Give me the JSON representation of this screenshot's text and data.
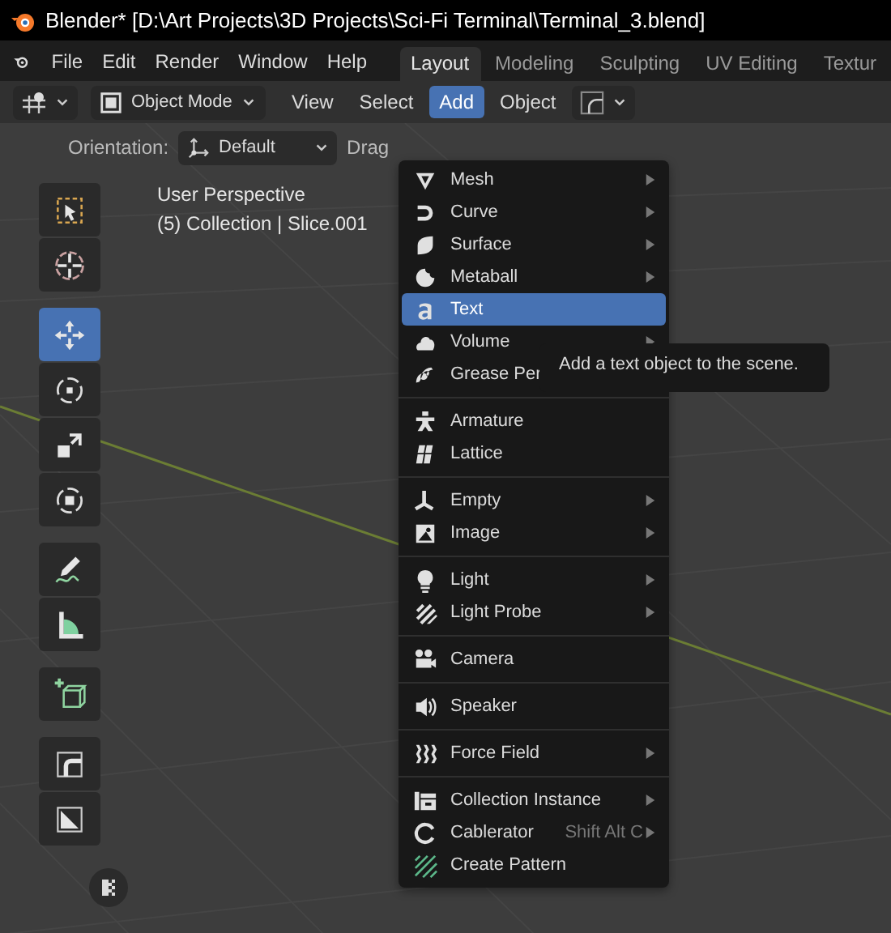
{
  "window": {
    "title": "Blender* [D:\\Art Projects\\3D Projects\\Sci-Fi Terminal\\Terminal_3.blend]"
  },
  "menu_bar": [
    "File",
    "Edit",
    "Render",
    "Window",
    "Help"
  ],
  "workspace_tabs": [
    {
      "label": "Layout",
      "selected": true
    },
    {
      "label": "Modeling",
      "selected": false
    },
    {
      "label": "Sculpting",
      "selected": false
    },
    {
      "label": "UV Editing",
      "selected": false
    },
    {
      "label": "Textur",
      "selected": false
    }
  ],
  "header": {
    "mode": "Object Mode",
    "menus": [
      {
        "label": "View",
        "selected": false
      },
      {
        "label": "Select",
        "selected": false
      },
      {
        "label": "Add",
        "selected": true
      },
      {
        "label": "Object",
        "selected": false
      }
    ]
  },
  "tool_settings": {
    "orientation_label": "Orientation:",
    "orientation": "Default",
    "drag_label": "Drag"
  },
  "viewport": {
    "view_name": "User Perspective",
    "context": "(5) Collection | Slice.001"
  },
  "toolbar": [
    [
      {
        "selected": false
      },
      {
        "selected": false
      }
    ],
    [
      {
        "selected": true
      },
      {
        "selected": false
      },
      {
        "selected": false
      },
      {
        "selected": false
      }
    ],
    [
      {
        "selected": false
      },
      {
        "selected": false
      }
    ],
    [
      {
        "selected": false
      }
    ],
    [
      {
        "selected": false
      },
      {
        "selected": false
      }
    ]
  ],
  "add_menu": [
    [
      {
        "label": "Mesh",
        "submenu": true,
        "selected": false
      },
      {
        "label": "Curve",
        "submenu": true,
        "selected": false
      },
      {
        "label": "Surface",
        "submenu": true,
        "selected": false
      },
      {
        "label": "Metaball",
        "submenu": true,
        "selected": false
      },
      {
        "label": "Text",
        "submenu": false,
        "selected": true
      },
      {
        "label": "Volume",
        "submenu": true,
        "selected": false
      },
      {
        "label": "Grease Per",
        "submenu": false,
        "selected": false
      }
    ],
    [
      {
        "label": "Armature",
        "submenu": false,
        "selected": false
      },
      {
        "label": "Lattice",
        "submenu": false,
        "selected": false
      }
    ],
    [
      {
        "label": "Empty",
        "submenu": true,
        "selected": false
      },
      {
        "label": "Image",
        "submenu": true,
        "selected": false
      }
    ],
    [
      {
        "label": "Light",
        "submenu": true,
        "selected": false
      },
      {
        "label": "Light Probe",
        "submenu": true,
        "selected": false
      }
    ],
    [
      {
        "label": "Camera",
        "submenu": false,
        "selected": false
      }
    ],
    [
      {
        "label": "Speaker",
        "submenu": false,
        "selected": false
      }
    ],
    [
      {
        "label": "Force Field",
        "submenu": true,
        "selected": false
      }
    ],
    [
      {
        "label": "Collection Instance",
        "submenu": true,
        "selected": false
      },
      {
        "label": "Cablerator",
        "submenu": true,
        "selected": false,
        "shortcut": "Shift Alt C"
      },
      {
        "label": "Create Pattern",
        "submenu": false,
        "selected": false
      }
    ]
  ],
  "tooltip": "Add a text object to the scene."
}
